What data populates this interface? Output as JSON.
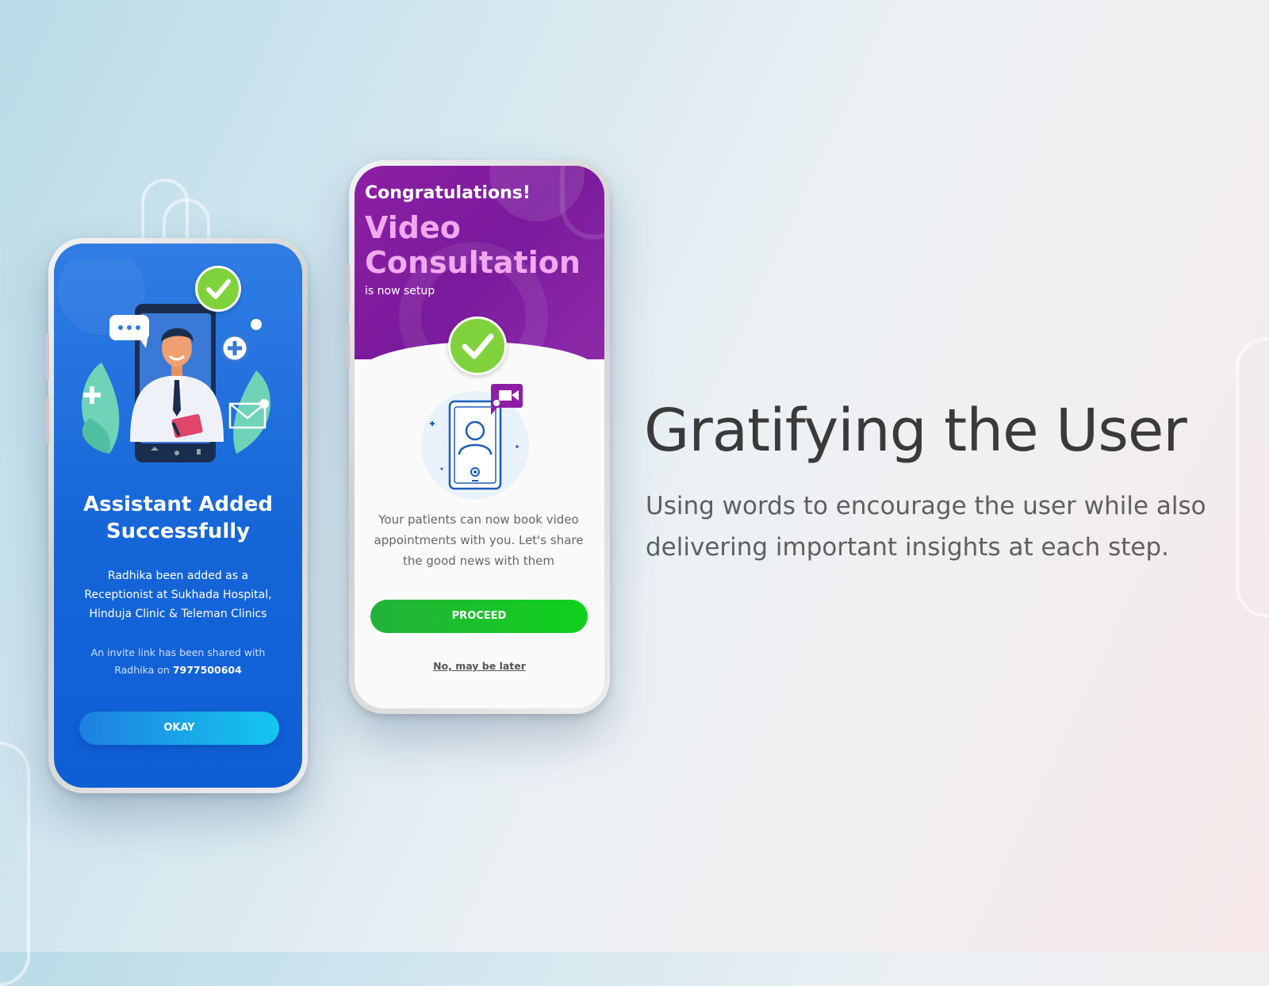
{
  "phone1": {
    "title": "Assistant Added Successfully",
    "description": "Radhika been added as a Receptionist at Sukhada Hospital, Hinduja Clinic & Teleman Clinics",
    "invite_prefix": "An invite link has been shared with Radhika on",
    "invite_phone": "7977500604",
    "okay_label": "OKAY",
    "illustration_icons": [
      "doctor-icon",
      "chat-bubble-icon",
      "plus-icon",
      "mail-icon",
      "checkmark-icon"
    ]
  },
  "phone2": {
    "congrats": "Congratulations!",
    "title_line1": "Video",
    "title_line2": "Consultation",
    "subtitle": "is now setup",
    "description": "Your patients can now book video appointments with you. Let's share the good news with them",
    "proceed_label": "PROCEED",
    "later_label": "No, may be later",
    "illustration_icons": [
      "phone-user-icon",
      "video-camera-icon",
      "checkmark-icon"
    ]
  },
  "hero": {
    "headline": "Gratifying the User",
    "subtext": "Using words to encourage the user while also delivering important insights at each step."
  },
  "colors": {
    "blue_screen": "#1565d8",
    "purple_header": "#7a1a9c",
    "accent_pink": "#f0a9ef",
    "success_green": "#7fd23c",
    "proceed_green": "#10d11b",
    "okay_cyan": "#14c7ef"
  }
}
